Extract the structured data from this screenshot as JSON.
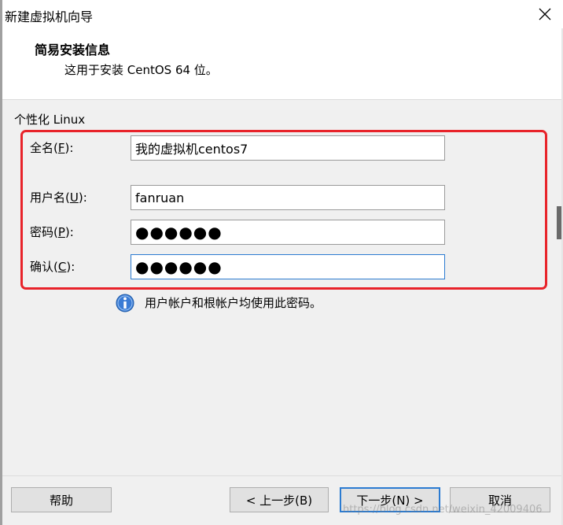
{
  "window": {
    "title": "新建虚拟机向导"
  },
  "header": {
    "title": "简易安装信息",
    "subtitle": "这用于安装 CentOS 64 位。"
  },
  "group": {
    "label": "个性化 Linux"
  },
  "fields": {
    "fullname": {
      "label_prefix": "全名(",
      "accel": "F",
      "label_suffix": "):",
      "value": "我的虚拟机centos7"
    },
    "username": {
      "label_prefix": "用户名(",
      "accel": "U",
      "label_suffix": "):",
      "value": "fanruan"
    },
    "password": {
      "label_prefix": "密码(",
      "accel": "P",
      "label_suffix": "):",
      "value": "●●●●●●"
    },
    "confirm": {
      "label_prefix": "确认(",
      "accel": "C",
      "label_suffix": "):",
      "value": "●●●●●●"
    }
  },
  "info": {
    "text": "用户帐户和根帐户均使用此密码。"
  },
  "buttons": {
    "help": "帮助",
    "back": "< 上一步(B)",
    "next": "下一步(N) >",
    "cancel": "取消"
  },
  "watermark": "https://blog.csdn.net/weixin_42009406",
  "colors": {
    "highlight": "#e8232a",
    "focus": "#2b7bd1",
    "info_icon": "#3a7bd5"
  }
}
